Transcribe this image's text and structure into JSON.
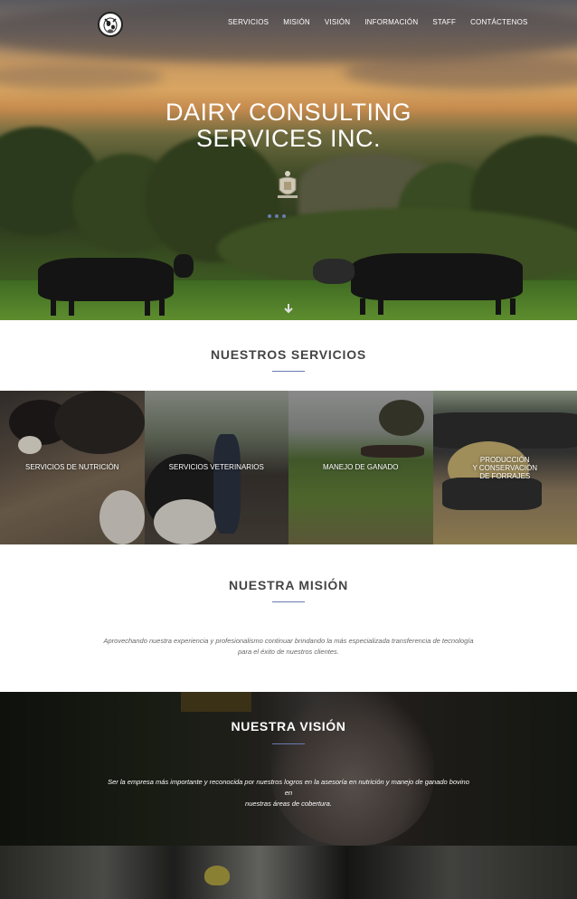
{
  "nav": {
    "logo_icon": "cow-logo-icon",
    "items": [
      "SERVICIOS",
      "MISIÓN",
      "VISIÓN",
      "INFORMACIÓN",
      "STAFF",
      "CONTÁCTENOS"
    ]
  },
  "hero": {
    "title_line1": "DAIRY CONSULTING",
    "title_line2": "SERVICES INC.",
    "scroll_icon": "arrow-down-icon"
  },
  "services": {
    "title": "NUESTROS SERVICIOS",
    "items": [
      {
        "label": "SERVICIOS DE NUTRICIÓN"
      },
      {
        "label": "SERVICIOS VETERINARIOS"
      },
      {
        "label": "MANEJO DE GANADO"
      },
      {
        "label_line1": "PRODUCCIÓN",
        "label_line2": "Y CONSERVACIÓN",
        "label_line3": "DE FORRAJES"
      }
    ]
  },
  "mission": {
    "title": "NUESTRA MISIÓN",
    "text_line1": "Aprovechando nuestra experiencia y profesionalismo continuar brindando la más especializada transferencia de tecnología",
    "text_line2": "para el éxito de nuestros clientes."
  },
  "vision": {
    "title": "NUESTRA VISIÓN",
    "text_line1": "Ser la empresa más importante y reconocida por nuestros logros en la asesoría en nutrición y manejo de ganado bovino en",
    "text_line2": "nuestras áreas de cobertura."
  },
  "colors": {
    "accent_rule": "#6a7bb0",
    "title_text": "#444444",
    "body_text": "#666666"
  }
}
